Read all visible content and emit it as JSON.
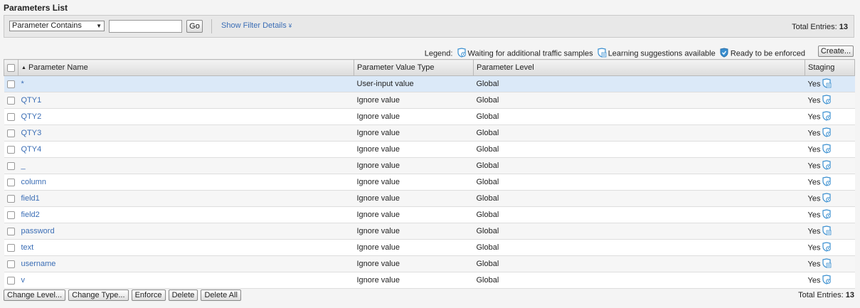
{
  "page_title": "Parameters List",
  "filter": {
    "select_value": "Parameter Contains",
    "go_label": "Go",
    "show_details_label": "Show Filter Details",
    "total_label": "Total Entries:",
    "total_value": "13"
  },
  "legend": {
    "label": "Legend:",
    "waiting": "Waiting for additional traffic samples",
    "learning": "Learning suggestions available",
    "ready": "Ready to be enforced",
    "create_label": "Create..."
  },
  "table": {
    "columns": [
      "Parameter Name",
      "Parameter Value Type",
      "Parameter Level",
      "Staging"
    ],
    "rows": [
      {
        "name": "*",
        "type": "User-input value",
        "level": "Global",
        "staging": "Yes",
        "icon": "learning-icon"
      },
      {
        "name": "QTY1",
        "type": "Ignore value",
        "level": "Global",
        "staging": "Yes",
        "icon": "waiting-icon"
      },
      {
        "name": "QTY2",
        "type": "Ignore value",
        "level": "Global",
        "staging": "Yes",
        "icon": "waiting-icon"
      },
      {
        "name": "QTY3",
        "type": "Ignore value",
        "level": "Global",
        "staging": "Yes",
        "icon": "waiting-icon"
      },
      {
        "name": "QTY4",
        "type": "Ignore value",
        "level": "Global",
        "staging": "Yes",
        "icon": "waiting-icon"
      },
      {
        "name": "_",
        "type": "Ignore value",
        "level": "Global",
        "staging": "Yes",
        "icon": "waiting-icon"
      },
      {
        "name": "column",
        "type": "Ignore value",
        "level": "Global",
        "staging": "Yes",
        "icon": "waiting-icon"
      },
      {
        "name": "field1",
        "type": "Ignore value",
        "level": "Global",
        "staging": "Yes",
        "icon": "waiting-icon"
      },
      {
        "name": "field2",
        "type": "Ignore value",
        "level": "Global",
        "staging": "Yes",
        "icon": "waiting-icon"
      },
      {
        "name": "password",
        "type": "Ignore value",
        "level": "Global",
        "staging": "Yes",
        "icon": "learning-icon"
      },
      {
        "name": "text",
        "type": "Ignore value",
        "level": "Global",
        "staging": "Yes",
        "icon": "waiting-icon"
      },
      {
        "name": "username",
        "type": "Ignore value",
        "level": "Global",
        "staging": "Yes",
        "icon": "learning-icon"
      },
      {
        "name": "v",
        "type": "Ignore value",
        "level": "Global",
        "staging": "Yes",
        "icon": "waiting-icon"
      }
    ]
  },
  "footer": {
    "buttons": [
      "Change Level...",
      "Change Type...",
      "Enforce",
      "Delete",
      "Delete All"
    ],
    "total_label": "Total Entries:",
    "total_value": "13"
  },
  "colors": {
    "link": "#3a6db5",
    "selected_row": "#dbe9f8"
  }
}
